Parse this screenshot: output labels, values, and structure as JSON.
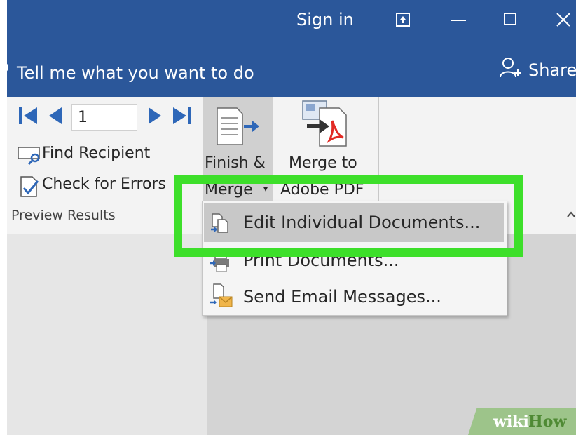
{
  "titlebar": {
    "sign_in": "Sign in",
    "restore_ribbon_icon": "ribbon-display-options-icon",
    "minimize_icon": "minimize-icon",
    "maximize_icon": "maximize-icon",
    "close_icon": "close-icon"
  },
  "tellbar": {
    "tell_me": "Tell me what you want to do",
    "share": "Share"
  },
  "ribbon": {
    "record_number": "1",
    "find_recipient": "Find Recipient",
    "check_for_errors": "Check for Errors",
    "group_label": "Preview Results",
    "finish_merge_line1": "Finish &",
    "finish_merge_line2": "Merge",
    "merge_pdf_line1": "Merge to",
    "merge_pdf_line2": "Adobe PDF"
  },
  "dropdown": {
    "items": [
      {
        "label": "Edit Individual Documents...",
        "icon": "edit-documents-icon",
        "highlighted": true
      },
      {
        "label": "Print Documents...",
        "icon": "print-documents-icon",
        "highlighted": false
      },
      {
        "label": "Send Email Messages...",
        "icon": "email-messages-icon",
        "highlighted": false
      }
    ]
  },
  "watermark": {
    "wiki": "wiki",
    "how": "How"
  },
  "colors": {
    "title_blue": "#2b579a",
    "highlight_green": "#3ddf2a",
    "ribbon_bg": "#f3f3f3",
    "accent_blue": "#2e67b8"
  }
}
